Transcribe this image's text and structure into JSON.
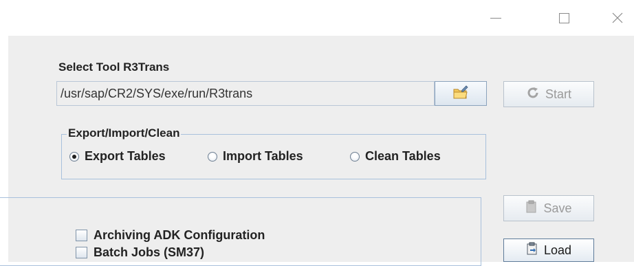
{
  "window": {
    "controls": {
      "minimize": "minimize-icon",
      "maximize": "maximize-icon",
      "close": "close-icon"
    }
  },
  "tool_section": {
    "label": "Select Tool R3Trans",
    "path_value": "/usr/sap/CR2/SYS/exe/run/R3trans",
    "browse_icon": "folder-edit-icon"
  },
  "buttons": {
    "start": {
      "label": "Start",
      "icon": "refresh-icon",
      "enabled": false
    },
    "save": {
      "label": "Save",
      "icon": "clipboard-icon",
      "enabled": false
    },
    "load": {
      "label": "Load",
      "icon": "clipboard-load-icon",
      "enabled": true
    }
  },
  "mode_group": {
    "title": "Export/Import/Clean",
    "options": [
      {
        "label": "Export Tables",
        "selected": true
      },
      {
        "label": "Import Tables",
        "selected": false
      },
      {
        "label": "Clean Tables",
        "selected": false
      }
    ]
  },
  "checklist": [
    {
      "label": "Archiving ADK Configuration",
      "checked": false
    },
    {
      "label": "Batch Jobs (SM37)",
      "checked": false
    }
  ],
  "colors": {
    "content_bg": "#eeeeee",
    "border_blue": "#a8c0dc",
    "disabled_text": "#9a9a9a"
  }
}
